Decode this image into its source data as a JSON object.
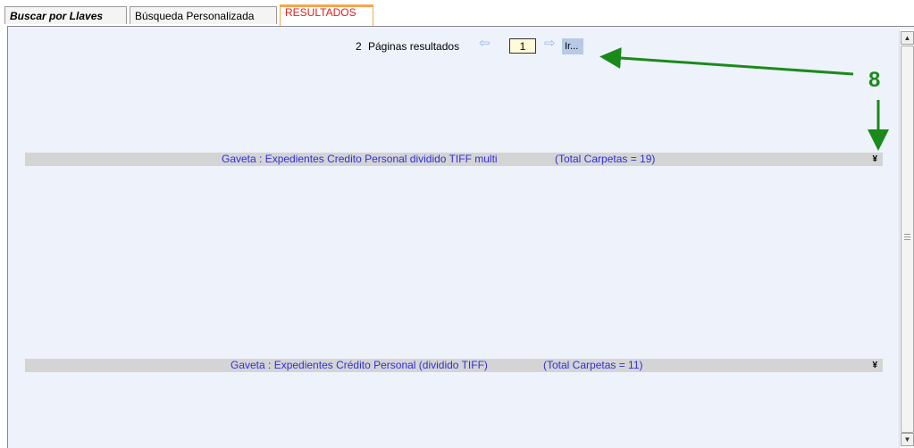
{
  "tabs": [
    {
      "label": "Buscar por Llaves"
    },
    {
      "label": "Búsqueda Personalizada"
    },
    {
      "label": "RESULTADOS",
      "active": true
    }
  ],
  "pager": {
    "count": "2",
    "label": "Páginas resultados",
    "page_value": "1",
    "go_label": "Ir..."
  },
  "groups": [
    {
      "text": "Gaveta : Expedientes Credito Personal dividido TIFF multi",
      "total": "(Total Carpetas = 19)"
    },
    {
      "text": "Gaveta : Expedientes Crédito Personal (dividido TIFF)",
      "total": "(Total Carpetas = 11)"
    }
  ],
  "annotation": {
    "number": "8",
    "color": "#1b8a1b"
  },
  "colors": {
    "panel_bg": "#eef2fb",
    "group_text": "#2f2fe0",
    "active_tab_text": "#e21c1c",
    "active_tab_border": "#f7a54b"
  },
  "icons": {
    "prev": "arrow-left-icon",
    "next": "arrow-right-icon",
    "expand": "double-chevron-down-icon"
  }
}
